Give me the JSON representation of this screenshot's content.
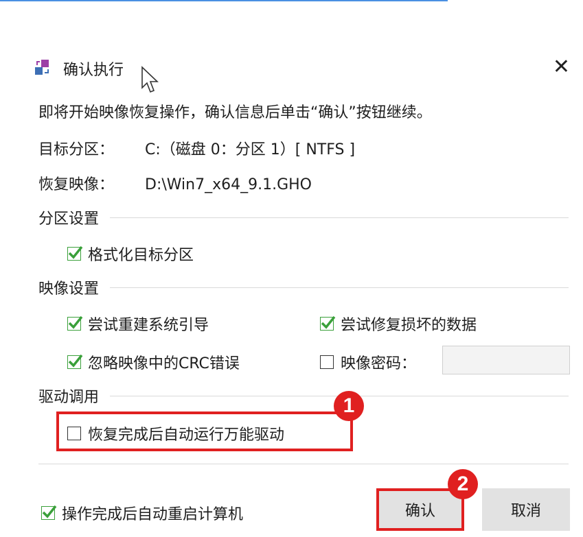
{
  "window": {
    "title": "确认执行"
  },
  "message": "即将开始映像恢复操作，确认信息后单击“确认”按钮继续。",
  "info": {
    "target_label": "目标分区：",
    "target_value": "C:（磁盘 0：分区 1）[ NTFS ]",
    "image_label": "恢复映像：",
    "image_value": "D:\\Win7_x64_9.1.GHO"
  },
  "partition_settings": {
    "title": "分区设置",
    "format_target": {
      "label": "格式化目标分区",
      "checked": true
    }
  },
  "image_settings": {
    "title": "映像设置",
    "rebuild_boot": {
      "label": "尝试重建系统引导",
      "checked": true
    },
    "repair_data": {
      "label": "尝试修复损坏的数据",
      "checked": true
    },
    "ignore_crc": {
      "label": "忽略映像中的CRC错误",
      "checked": true
    },
    "image_password": {
      "label": "映像密码：",
      "checked": false,
      "value": ""
    }
  },
  "driver": {
    "title": "驱动调用",
    "auto_driver": {
      "label": "恢复完成后自动运行万能驱动",
      "checked": false
    }
  },
  "footer": {
    "auto_restart": {
      "label": "操作完成后自动重启计算机",
      "checked": true
    },
    "confirm_label": "确认",
    "cancel_label": "取消"
  },
  "annotations": {
    "badge1": "1",
    "badge2": "2"
  },
  "colors": {
    "accent_red": "#e02020",
    "check_green": "#3aa03a",
    "top_line": "#4a90e2"
  }
}
